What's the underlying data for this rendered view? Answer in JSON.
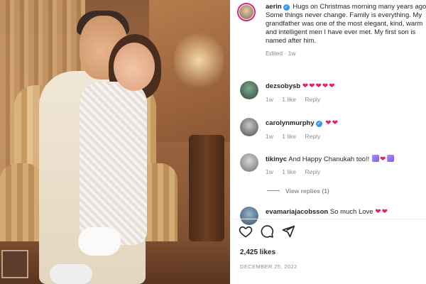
{
  "post": {
    "caption": {
      "username": "aerin",
      "text": "Hugs on Christmas morning many years ago. Some things never change. Family is everything. My grandfather was one of the most elegant, kind, warm and intelligent men I have ever met. My first son is named after him.",
      "edited": "Edited · 1w"
    },
    "comments": [
      {
        "username": "dezsobysb",
        "text": "❤❤❤❤❤",
        "time": "1w",
        "likes": "1 like",
        "reply": "Reply"
      },
      {
        "username": "carolynmurphy",
        "text": "❤❤",
        "time": "1w",
        "likes": "1 like",
        "reply": "Reply"
      },
      {
        "username": "tikinyc",
        "text": "And Happy Chanukah too!!",
        "time": "1w",
        "likes": "1 like",
        "reply": "Reply",
        "view_replies": "View replies (1)"
      },
      {
        "username": "evamariajacobsson",
        "text": "So much Love",
        "hearts": "❤❤"
      }
    ],
    "likes": "2,425 likes",
    "date": "DECEMBER 25, 2022"
  },
  "colors": {
    "verified": "#3897f0",
    "heart": "#e0245e",
    "muted": "#8e8e8e",
    "text": "#262626"
  },
  "icons": {
    "like": "heart-outline-icon",
    "comment": "comment-bubble-icon",
    "share": "paper-plane-icon",
    "verified": "verified-badge-icon"
  }
}
